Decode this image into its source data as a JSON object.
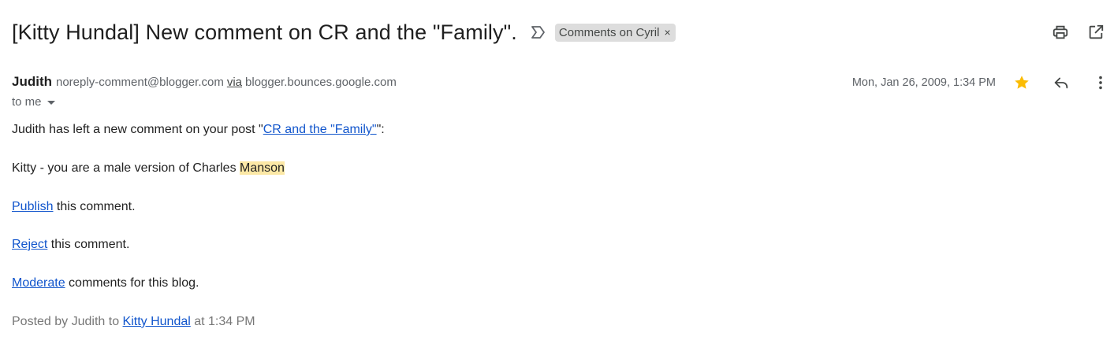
{
  "header": {
    "subject": "[Kitty Hundal] New comment on CR and the \"Family\".",
    "label_chip": "Comments on Cyril",
    "label_remove_symbol": "×",
    "importance_icon": "importance-marker-icon",
    "actions": {
      "print_icon": "printer-icon",
      "new_window_icon": "open-in-new-window-icon"
    }
  },
  "sender": {
    "name": "Judith",
    "email": "noreply-comment@blogger.com",
    "via_label": "via",
    "via_domain": "blogger.bounces.google.com",
    "recipient": "to me",
    "date": "Mon, Jan 26, 2009, 1:34 PM",
    "star_color": "#fbbc04",
    "icons": {
      "star": "star-icon",
      "reply": "reply-icon",
      "more": "more-vertical-icon"
    }
  },
  "body": {
    "intro_prefix": "Judith has left a new comment on your post \"",
    "intro_link": "CR and the \"Family\"",
    "intro_suffix": "\":",
    "comment_prefix": "Kitty - you are a male version of Charles ",
    "comment_highlight": "Manson",
    "publish_link": "Publish",
    "publish_suffix": " this comment.",
    "reject_link": "Reject",
    "reject_suffix": " this comment.",
    "moderate_link": "Moderate",
    "moderate_suffix": " comments for this blog.",
    "posted_prefix": "Posted by Judith to ",
    "posted_link": "Kitty Hundal",
    "posted_suffix": " at 1:34 PM"
  },
  "colors": {
    "link": "#1155cc",
    "highlight": "#fce8a6",
    "chip_bg": "#dddddd"
  }
}
